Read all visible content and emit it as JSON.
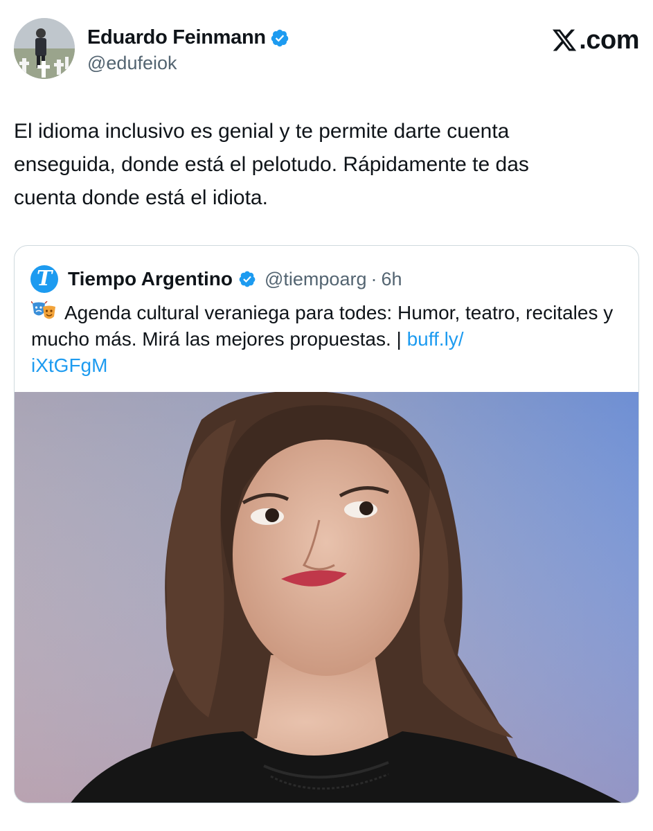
{
  "tweet": {
    "author_name": "Eduardo Feinmann",
    "author_handle": "@edufeiok",
    "avatar_icon": "user-avatar",
    "verified_icon": "verified-badge-icon",
    "text": "El idioma inclusivo es genial y te permite darte cuenta\nenseguida,  donde está el pelotudo. Rápidamente te das\ncuenta donde está el idiota."
  },
  "brand": {
    "logo_icon": "x-logo-icon",
    "label": ".com"
  },
  "quoted_tweet": {
    "avatar_letter": "T",
    "author_name": "Tiempo Argentino",
    "author_handle": "@tiempoarg",
    "separator": "·",
    "time": "6h",
    "emoji_icon": "theater-masks-icon",
    "text": "Agenda cultural veraniega para todes: Humor, teatro, recitales y mucho más. Mirá las mejores propuestas. | ",
    "link": "buff.ly/\niXtGFgM",
    "media_icon": "portrait-photo"
  },
  "colors": {
    "accent": "#1d9bf0",
    "text": "#0f1419",
    "secondary": "#536471",
    "border": "#cfd9de"
  }
}
